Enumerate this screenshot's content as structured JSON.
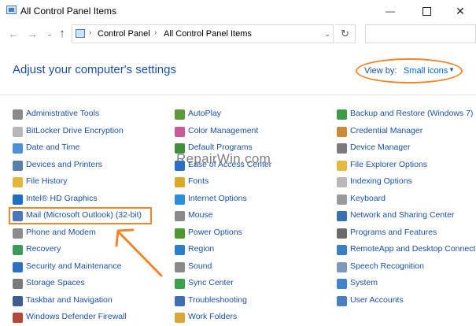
{
  "window": {
    "title": "All Control Panel Items",
    "minimize_glyph": "—",
    "close_glyph": "✕"
  },
  "nav": {
    "back_glyph": "←",
    "forward_glyph": "→",
    "recent_glyph": "⌄",
    "up_glyph": "↑",
    "breadcrumb": [
      "Control Panel",
      "All Control Panel Items"
    ],
    "separator": "›",
    "dropdown_glyph": "⌄",
    "refresh_glyph": "↻"
  },
  "header": {
    "title": "Adjust your computer's settings",
    "view_by_label": "View by:",
    "view_by_value": "Small icons",
    "view_by_caret": "▼"
  },
  "watermark": "RepairWin.com",
  "columns": [
    [
      {
        "label": "Administrative Tools",
        "color": "#8a8a8a"
      },
      {
        "label": "BitLocker Drive Encryption",
        "color": "#b7b7b7"
      },
      {
        "label": "Date and Time",
        "color": "#4f8fd6"
      },
      {
        "label": "Devices and Printers",
        "color": "#5a7fa8"
      },
      {
        "label": "File History",
        "color": "#e2b53b"
      },
      {
        "label": "Intel® HD Graphics",
        "color": "#1d6fc2"
      },
      {
        "label": "Mail (Microsoft Outlook) (32-bit)",
        "color": "#4a78b8"
      },
      {
        "label": "Phone and Modem",
        "color": "#8c8c8c"
      },
      {
        "label": "Recovery",
        "color": "#3c9a5a"
      },
      {
        "label": "Security and Maintenance",
        "color": "#2f6fc0"
      },
      {
        "label": "Storage Spaces",
        "color": "#7a7a7a"
      },
      {
        "label": "Taskbar and Navigation",
        "color": "#3a5f8e"
      },
      {
        "label": "Windows Defender Firewall",
        "color": "#b5473b"
      }
    ],
    [
      {
        "label": "AutoPlay",
        "color": "#5a9a3c"
      },
      {
        "label": "Color Management",
        "color": "#c95a9a"
      },
      {
        "label": "Default Programs",
        "color": "#3f8f3f"
      },
      {
        "label": "Ease of Access Center",
        "color": "#2a6fc4"
      },
      {
        "label": "Fonts",
        "color": "#d9a92a"
      },
      {
        "label": "Internet Options",
        "color": "#2b8fd6"
      },
      {
        "label": "Mouse",
        "color": "#8a8a8a"
      },
      {
        "label": "Power Options",
        "color": "#4c9a2f"
      },
      {
        "label": "Region",
        "color": "#2a7fc8"
      },
      {
        "label": "Sound",
        "color": "#8a8a8a"
      },
      {
        "label": "Sync Center",
        "color": "#3aa04a"
      },
      {
        "label": "Troubleshooting",
        "color": "#3f6fb0"
      },
      {
        "label": "Work Folders",
        "color": "#d6a93a"
      }
    ],
    [
      {
        "label": "Backup and Restore (Windows 7)",
        "color": "#3f9a4a"
      },
      {
        "label": "Credential Manager",
        "color": "#c98a3a"
      },
      {
        "label": "Device Manager",
        "color": "#7a7a7a"
      },
      {
        "label": "File Explorer Options",
        "color": "#e0bb3f"
      },
      {
        "label": "Indexing Options",
        "color": "#b8b8b8"
      },
      {
        "label": "Keyboard",
        "color": "#9a9a9a"
      },
      {
        "label": "Network and Sharing Center",
        "color": "#3a6fb0"
      },
      {
        "label": "Programs and Features",
        "color": "#6a6a6a"
      },
      {
        "label": "RemoteApp and Desktop Connections",
        "color": "#3a7fc0"
      },
      {
        "label": "Speech Recognition",
        "color": "#7a9ab8"
      },
      {
        "label": "System",
        "color": "#3f83c9"
      },
      {
        "label": "User Accounts",
        "color": "#4a7fc0"
      }
    ]
  ],
  "colors": {
    "link": "#1b4f9c",
    "title": "#1e4e9a",
    "highlight": "#f0862b"
  }
}
